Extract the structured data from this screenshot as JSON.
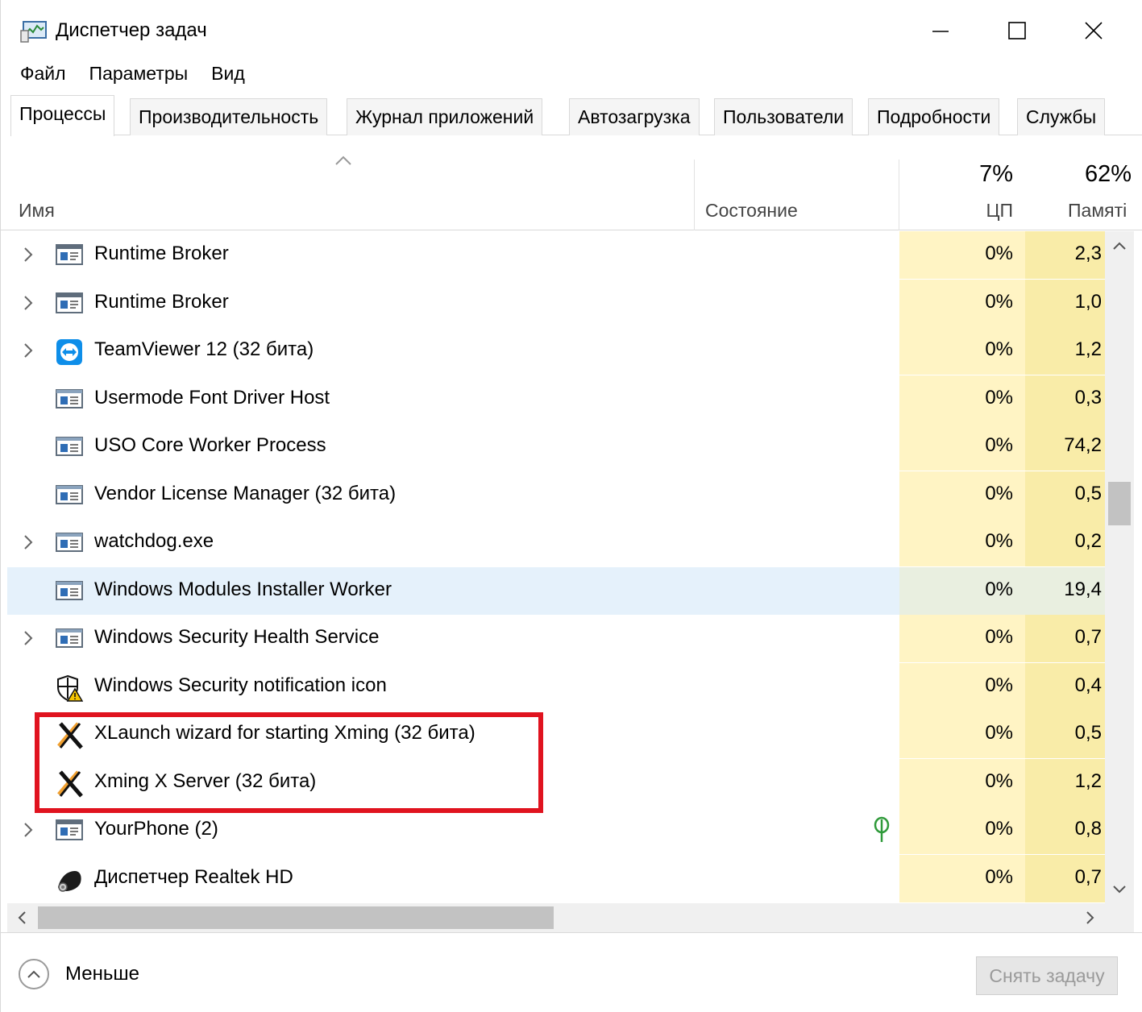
{
  "window": {
    "title": "Диспетчер задач",
    "icon": "task-manager-icon"
  },
  "menu": [
    "Файл",
    "Параметры",
    "Вид"
  ],
  "tabs": [
    {
      "label": "Процессы",
      "active": true
    },
    {
      "label": "Производительность",
      "active": false
    },
    {
      "label": "Журнал приложений",
      "active": false
    },
    {
      "label": "Автозагрузка",
      "active": false
    },
    {
      "label": "Пользователи",
      "active": false
    },
    {
      "label": "Подробности",
      "active": false
    },
    {
      "label": "Службы",
      "active": false
    }
  ],
  "columns": {
    "name": "Имя",
    "status": "Состояние",
    "cpu_label": "ЦП",
    "cpu_total": "7%",
    "mem_label": "Памяті",
    "mem_total": "62%"
  },
  "processes": [
    {
      "name": "Runtime Broker",
      "icon": "app-window-icon",
      "expandable": true,
      "cpu": "0%",
      "mem": "2,3",
      "selected": false
    },
    {
      "name": "Runtime Broker",
      "icon": "app-window-icon",
      "expandable": true,
      "cpu": "0%",
      "mem": "1,0",
      "selected": false
    },
    {
      "name": "TeamViewer 12 (32 бита)",
      "icon": "teamviewer-icon",
      "expandable": true,
      "cpu": "0%",
      "mem": "1,2",
      "selected": false
    },
    {
      "name": "Usermode Font Driver Host",
      "icon": "process-window-icon",
      "expandable": false,
      "cpu": "0%",
      "mem": "0,3",
      "selected": false
    },
    {
      "name": "USO Core Worker Process",
      "icon": "process-window-icon",
      "expandable": false,
      "cpu": "0%",
      "mem": "74,2",
      "selected": false
    },
    {
      "name": "Vendor License Manager (32 бита)",
      "icon": "process-window-icon",
      "expandable": false,
      "cpu": "0%",
      "mem": "0,5",
      "selected": false
    },
    {
      "name": "watchdog.exe",
      "icon": "process-window-icon",
      "expandable": true,
      "cpu": "0%",
      "mem": "0,2",
      "selected": false
    },
    {
      "name": "Windows Modules Installer Worker",
      "icon": "process-window-icon",
      "expandable": false,
      "cpu": "0%",
      "mem": "19,4",
      "selected": true
    },
    {
      "name": "Windows Security Health Service",
      "icon": "process-window-icon",
      "expandable": true,
      "cpu": "0%",
      "mem": "0,7",
      "selected": false
    },
    {
      "name": "Windows Security notification icon",
      "icon": "shield-warning-icon",
      "expandable": false,
      "cpu": "0%",
      "mem": "0,4",
      "selected": false
    },
    {
      "name": "XLaunch wizard for starting Xming (32 бита)",
      "icon": "xming-icon",
      "expandable": false,
      "cpu": "0%",
      "mem": "0,5",
      "selected": false
    },
    {
      "name": "Xming X Server (32 бита)",
      "icon": "xming-icon",
      "expandable": false,
      "cpu": "0%",
      "mem": "1,2",
      "selected": false
    },
    {
      "name": "YourPhone (2)",
      "icon": "app-window-icon",
      "expandable": true,
      "cpu": "0%",
      "mem": "0,8",
      "selected": false,
      "status_icon": "leaf-suspended-icon"
    },
    {
      "name": "Диспетчер Realtek HD",
      "icon": "realtek-speaker-icon",
      "expandable": false,
      "cpu": "0%",
      "mem": "0,7",
      "selected": false
    }
  ],
  "footer": {
    "less_label": "Меньше",
    "end_task_label": "Снять задачу"
  },
  "colors": {
    "cpu_column_bg": "#fff4c4",
    "mem_column_bg": "#f9eca8",
    "selected_row_bg": "#e5f1fb",
    "highlight_box": "#e0131f"
  }
}
